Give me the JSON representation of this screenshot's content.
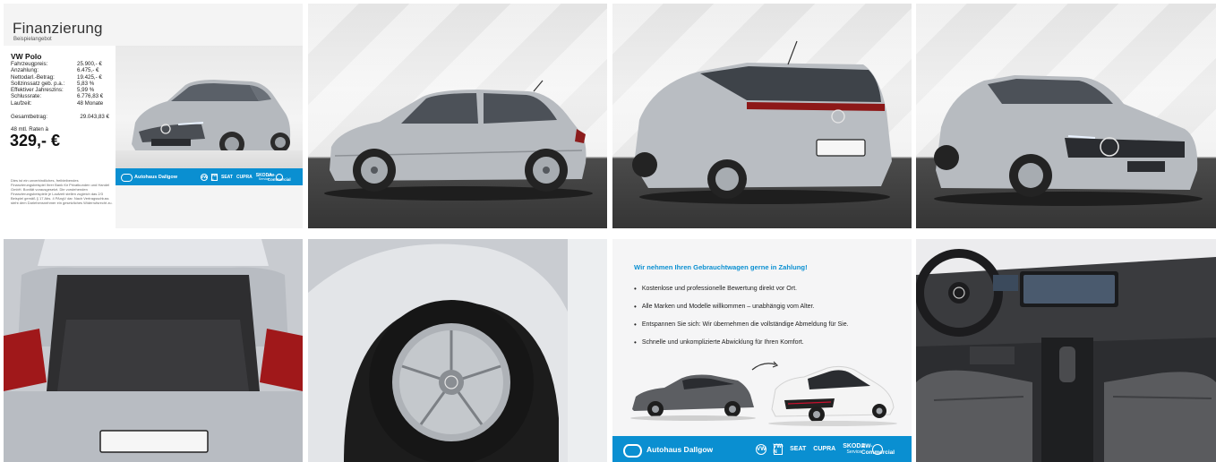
{
  "finance": {
    "title": "Finanzierung",
    "subtitle": "Beispielangebot",
    "model": "VW Polo",
    "rows": [
      {
        "label": "Fahrzeugpreis:",
        "value": "25.900,- €"
      },
      {
        "label": "Anzahlung:",
        "value": "6.475,- €"
      },
      {
        "label": "Nettodarl.-Betrag:",
        "value": "19.425,- €"
      },
      {
        "label": "Sollzinssatz geb. p.a.:",
        "value": "5,83 %"
      },
      {
        "label": "Effektiver Jahreszins:",
        "value": "5,99 %"
      },
      {
        "label": "Schlussrate:",
        "value": "6.776,83 €"
      },
      {
        "label": "Laufzeit:",
        "value": "48 Monate"
      }
    ],
    "total_label": "Gesamtbetrag:",
    "total_value": "29.043,83 €",
    "rate_label": "48 mtl. Raten à",
    "rate_value": "329,- €",
    "disclaimer": "Dies ist ein unverbindliches, freibleibendes Finanzierungsbeispiel Ihrer Bank für Privatkunden und Handel GmbH. Bonität vorausgesetzt. Die vorstehenden Finanzierungsbeispiele je Laufzeit stellen zugleich das 2/3 Beispiel gemäß § 17 Abs. 4 PAngV dar. Nach Vertragsschluss steht dem Darlehensnehmer ein gesetzliches Widerrufsrecht zu."
  },
  "dealer": {
    "name": "Autohaus Dallgow",
    "brands": [
      "VW",
      "VW-N",
      "SEAT",
      "CUPRA",
      "SKODA",
      "Service",
      "VW-Commercial"
    ]
  },
  "tradein": {
    "title": "Wir nehmen Ihren Gebrauchtwagen gerne in Zahlung!",
    "items": [
      "Kostenlose und professionelle Bewertung direkt vor Ort.",
      "Alle Marken und Modelle willkommen – unabhängig vom Alter.",
      "Entspannen Sie sich: Wir übernehmen die vollständige Abmeldung für Sie.",
      "Schnelle und unkomplizierte Abwicklung für Ihren Komfort."
    ]
  },
  "colors": {
    "accent": "#0a8fd1",
    "car_silver": "#b9bdc2",
    "floor": "#3c3c3c"
  }
}
